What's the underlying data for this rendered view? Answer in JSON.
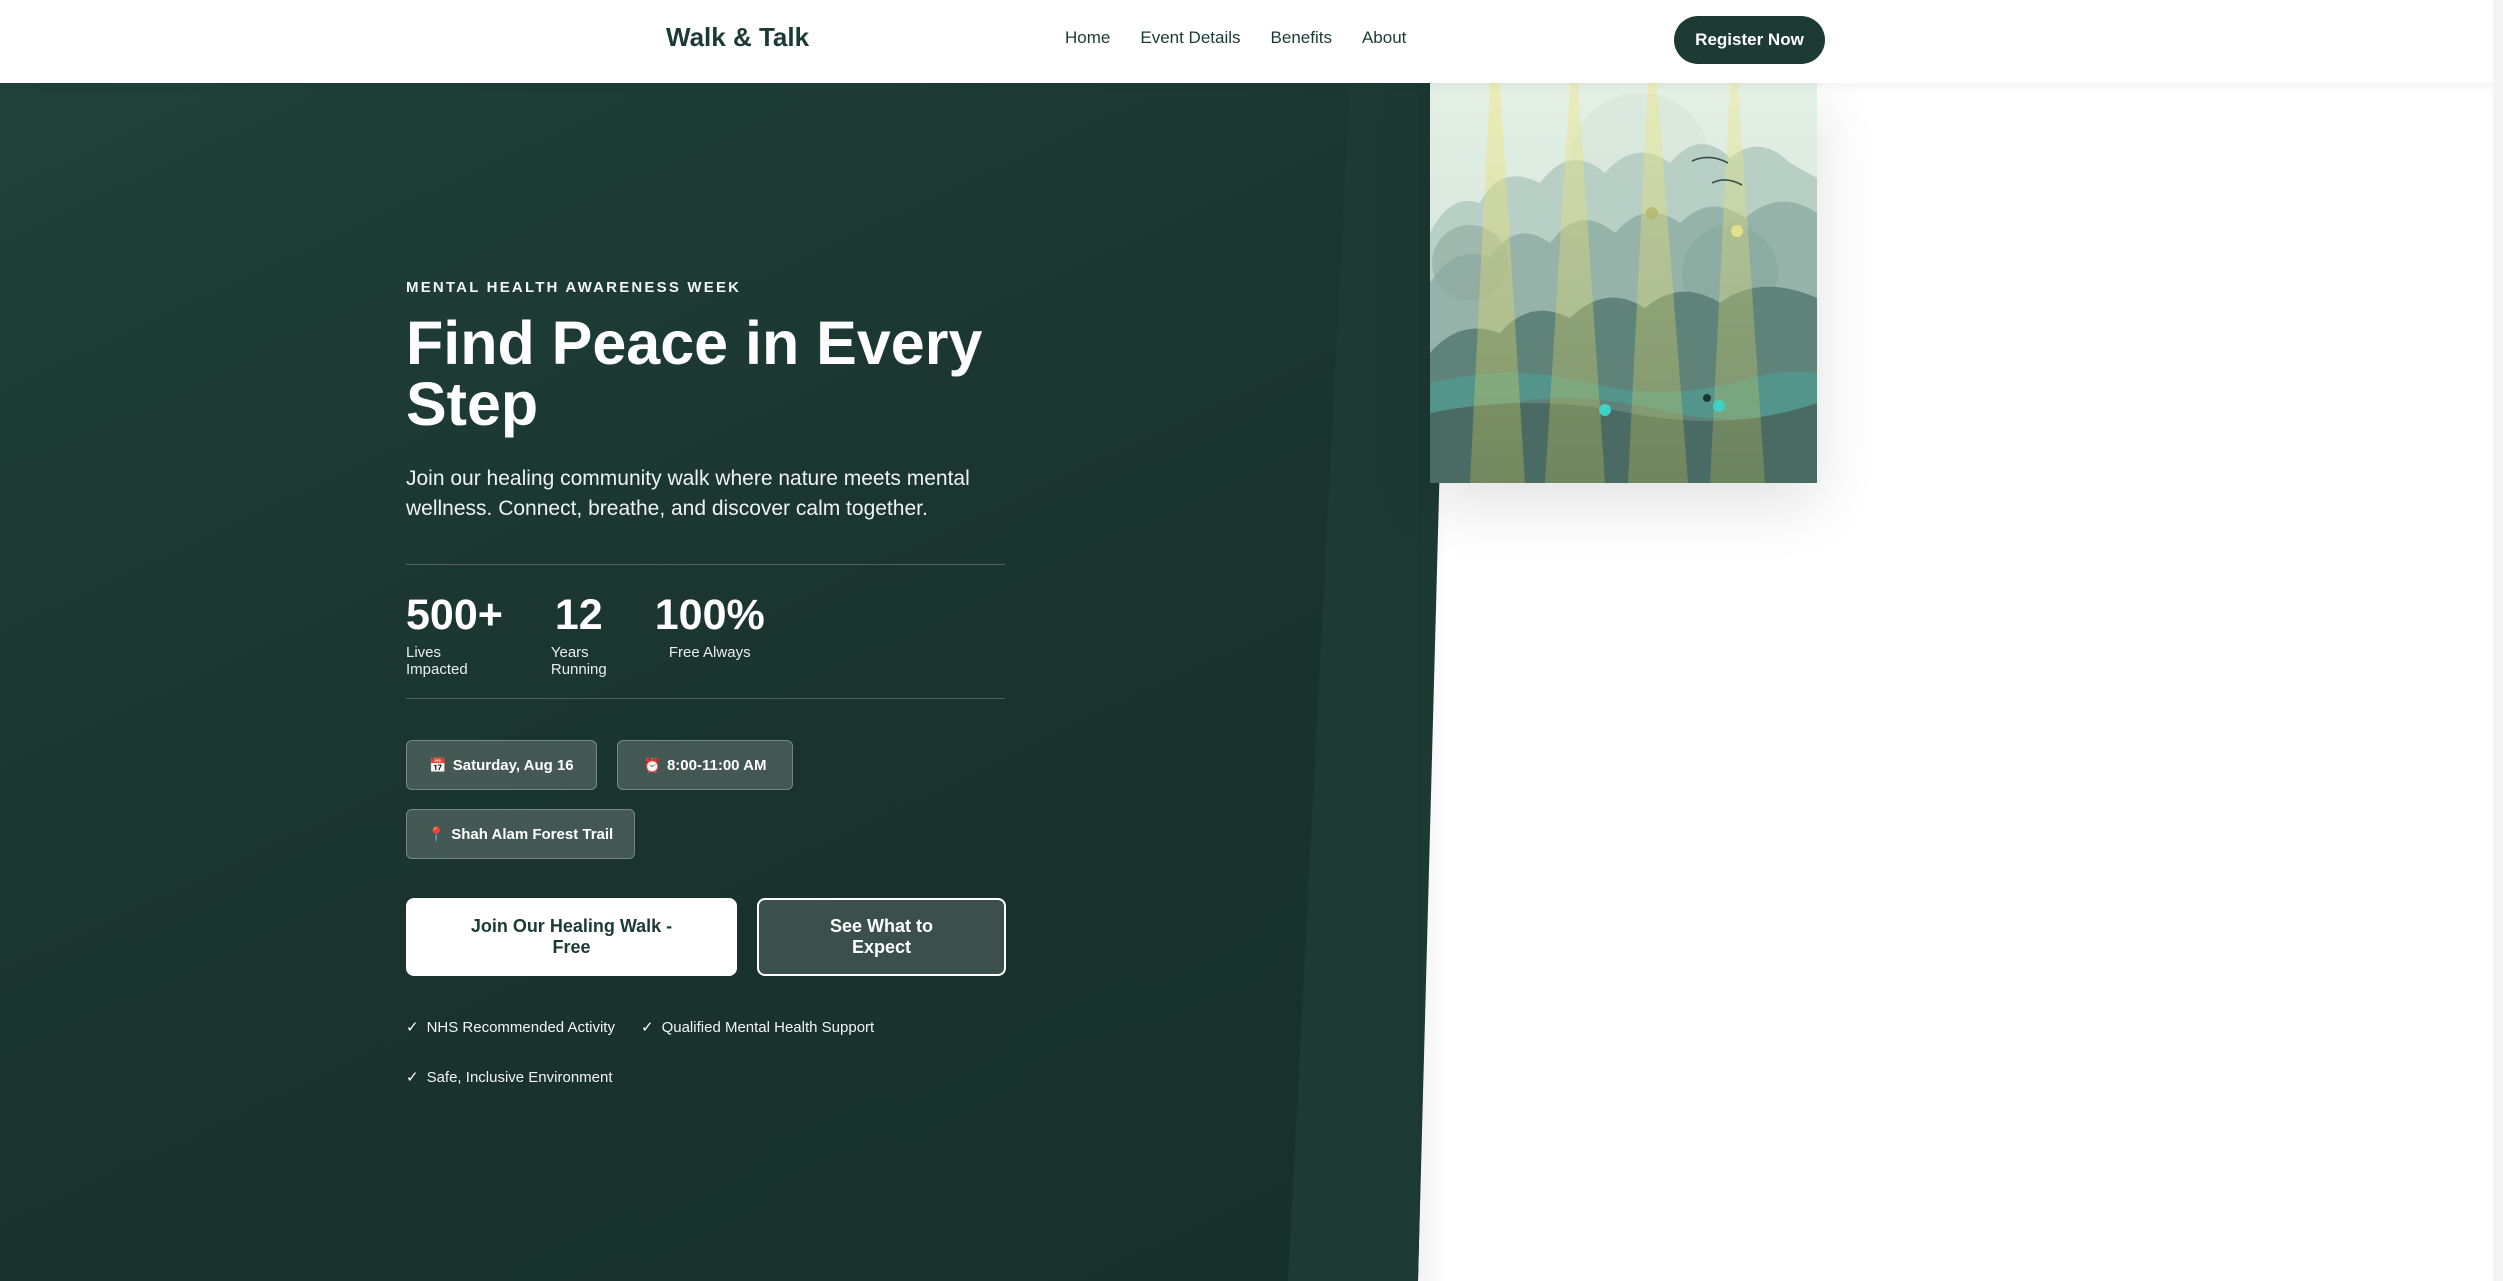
{
  "nav": {
    "brand": "Walk & Talk",
    "links": [
      "Home",
      "Event Details",
      "Benefits",
      "About"
    ],
    "cta": "Register Now"
  },
  "hero": {
    "eyebrow": "MENTAL HEALTH AWARENESS WEEK",
    "title": "Find Peace in Every Step",
    "subtitle": "Join our healing community walk where nature meets mental wellness. Connect, breathe, and discover calm together.",
    "stats": [
      {
        "value": "500+",
        "label": "Lives Impacted"
      },
      {
        "value": "12",
        "label": "Years Running"
      },
      {
        "value": "100%",
        "label": "Free Always"
      }
    ],
    "chips": [
      {
        "icon": "📅",
        "icon_name": "calendar-icon",
        "label": "Saturday, Aug 16"
      },
      {
        "icon": "⏰",
        "icon_name": "alarm-clock-icon",
        "label": "8:00-11:00 AM"
      },
      {
        "icon": "📍",
        "icon_name": "location-pin-icon",
        "label": "Shah Alam Forest Trail"
      }
    ],
    "primary_button": "Join Our Healing Walk - Free",
    "secondary_button": "See What to Expect",
    "trust": [
      "NHS Recommended Activity",
      "Qualified Mental Health Support",
      "Safe, Inclusive Environment"
    ]
  },
  "colors": {
    "brand_dark": "#1d3a33",
    "hero_bg": "#1b3530",
    "accent_teal": "#3fd1c4",
    "light_beam": "#e8e07a"
  }
}
